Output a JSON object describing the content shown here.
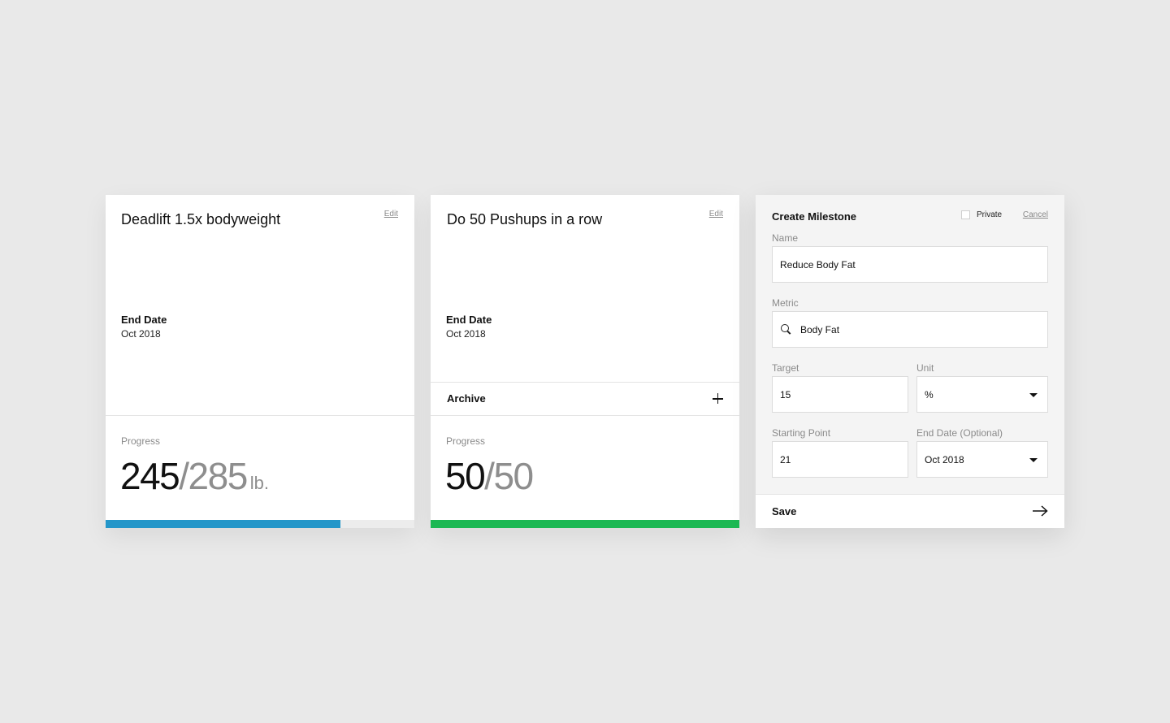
{
  "cards": [
    {
      "title": "Deadlift 1.5x bodyweight",
      "edit_label": "Edit",
      "end_date_label": "End Date",
      "end_date_value": "Oct 2018",
      "progress_label": "Progress",
      "progress_current": "245",
      "progress_separator": "/",
      "progress_target": "285",
      "progress_unit": "lb.",
      "progress_fraction": 0.76,
      "bar_color": "#2496c9"
    },
    {
      "title": "Do 50 Pushups in a row",
      "edit_label": "Edit",
      "end_date_label": "End Date",
      "end_date_value": "Oct 2018",
      "archive_label": "Archive",
      "archive_icon": "plus-icon",
      "progress_label": "Progress",
      "progress_current": "50",
      "progress_separator": "/",
      "progress_target": "50",
      "progress_fraction": 1.0,
      "bar_color": "#1cb853"
    }
  ],
  "form": {
    "title": "Create Milestone",
    "private_label": "Private",
    "private_checked": false,
    "cancel_label": "Cancel",
    "name": {
      "label": "Name",
      "value": "Reduce Body Fat"
    },
    "metric": {
      "label": "Metric",
      "value": "Body Fat",
      "icon": "search-icon"
    },
    "target": {
      "label": "Target",
      "value": "15"
    },
    "unit": {
      "label": "Unit",
      "value": "%",
      "icon": "caret-down-icon"
    },
    "starting_point": {
      "label": "Starting Point",
      "value": "21"
    },
    "end_date": {
      "label": "End Date (Optional)",
      "value": "Oct 2018",
      "icon": "caret-down-icon"
    },
    "save_label": "Save",
    "save_icon": "arrow-right-icon"
  }
}
